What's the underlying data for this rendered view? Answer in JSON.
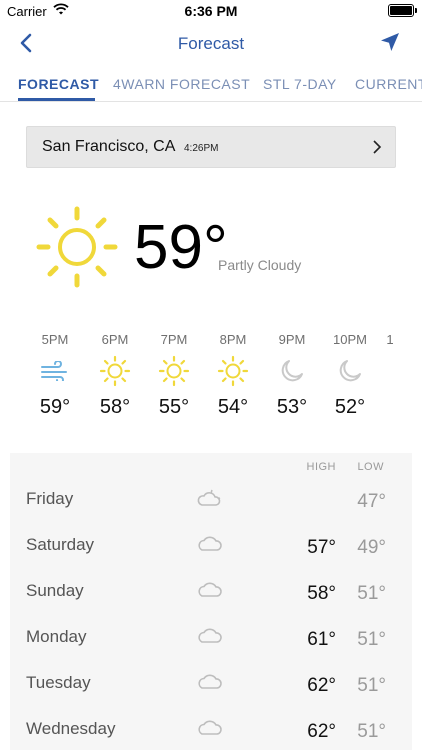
{
  "status": {
    "carrier": "Carrier",
    "time": "6:36 PM"
  },
  "nav": {
    "title": "Forecast"
  },
  "tabs": [
    {
      "label": "FORECAST",
      "active": true
    },
    {
      "label": "4WARN FORECAST",
      "active": false
    },
    {
      "label": "STL 7-DAY",
      "active": false
    },
    {
      "label": "CURRENT",
      "active": false
    }
  ],
  "location": {
    "name": "San Francisco, CA",
    "time": "4:26PM"
  },
  "current": {
    "temp": "59°",
    "condition": "Partly Cloudy",
    "icon": "sun-icon"
  },
  "hourly": [
    {
      "time": "5PM",
      "icon": "wind-icon",
      "temp": "59°"
    },
    {
      "time": "6PM",
      "icon": "sun-icon",
      "temp": "58°"
    },
    {
      "time": "7PM",
      "icon": "sun-icon",
      "temp": "55°"
    },
    {
      "time": "8PM",
      "icon": "sun-icon",
      "temp": "54°"
    },
    {
      "time": "9PM",
      "icon": "moon-icon",
      "temp": "53°"
    },
    {
      "time": "10PM",
      "icon": "moon-icon",
      "temp": "52°"
    },
    {
      "time": "1",
      "icon": "",
      "temp": ""
    }
  ],
  "daily": {
    "high_label": "HIGH",
    "low_label": "LOW",
    "days": [
      {
        "name": "Friday",
        "icon": "partly-cloudy-night-icon",
        "high": "",
        "low": "47°"
      },
      {
        "name": "Saturday",
        "icon": "cloud-icon",
        "high": "57°",
        "low": "49°"
      },
      {
        "name": "Sunday",
        "icon": "cloud-icon",
        "high": "58°",
        "low": "51°"
      },
      {
        "name": "Monday",
        "icon": "cloud-icon",
        "high": "61°",
        "low": "51°"
      },
      {
        "name": "Tuesday",
        "icon": "cloud-icon",
        "high": "62°",
        "low": "51°"
      },
      {
        "name": "Wednesday",
        "icon": "cloud-icon",
        "high": "62°",
        "low": "51°"
      }
    ]
  },
  "colors": {
    "accent": "#2f5aa6",
    "tab_inactive": "#7b8fb5",
    "sun": "#f0d83a",
    "wind": "#6fb3e0",
    "moon": "#c9c9c9",
    "cloud": "#bdbdbd"
  }
}
